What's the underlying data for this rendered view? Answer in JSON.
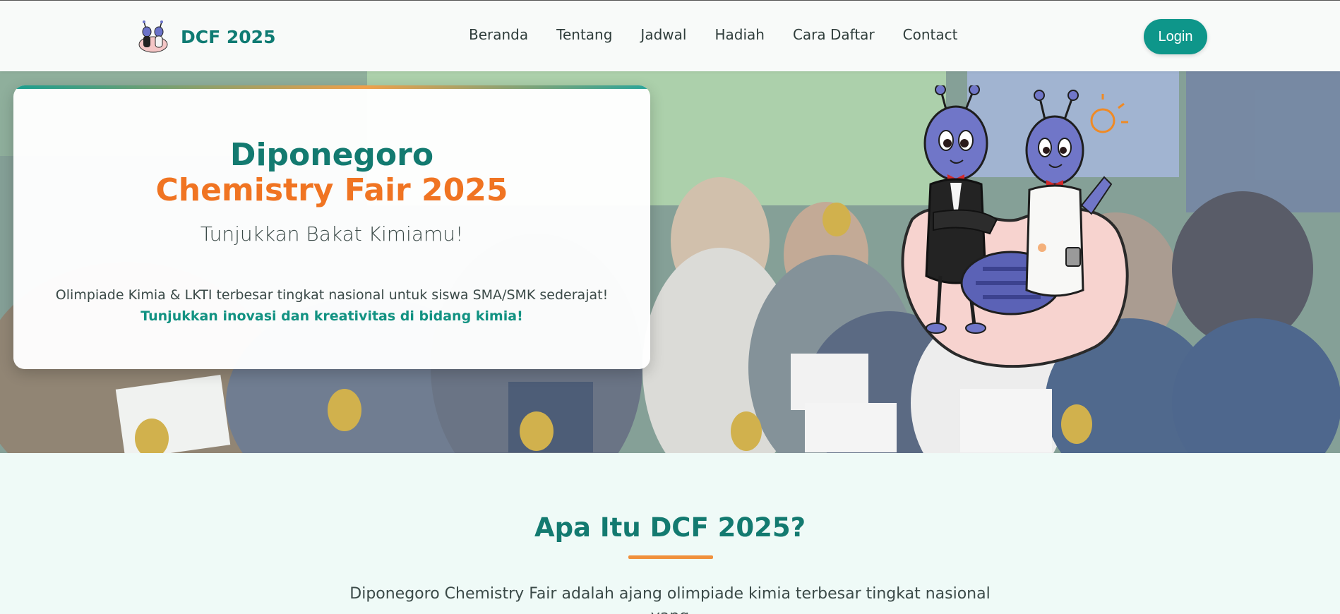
{
  "brand": {
    "name": "DCF 2025",
    "logo_icon": "ant-mascot-logo-icon"
  },
  "nav": {
    "links": [
      "Beranda",
      "Tentang",
      "Jadwal",
      "Hadiah",
      "Cara Daftar",
      "Contact"
    ],
    "login_label": "Login"
  },
  "hero": {
    "title_line1": "Diponegoro",
    "title_line2": "Chemistry Fair 2025",
    "tagline": "Tunjukkan Bakat Kimiamu!",
    "description": "Olimpiade Kimia & LKTI terbesar tingkat nasional untuk siswa SMA/SMK sederajat!",
    "highlight": "Tunjukkan inovasi dan kreativitas di bidang kimia!",
    "mascot_icon": "ant-mascots-illustration"
  },
  "about": {
    "title": "Apa Itu DCF 2025?",
    "text": "Diponegoro Chemistry Fair adalah ajang olimpiade kimia terbesar tingkat nasional yang"
  },
  "colors": {
    "primary": "#137a70",
    "accent": "#f07422",
    "button": "#0e968a"
  }
}
